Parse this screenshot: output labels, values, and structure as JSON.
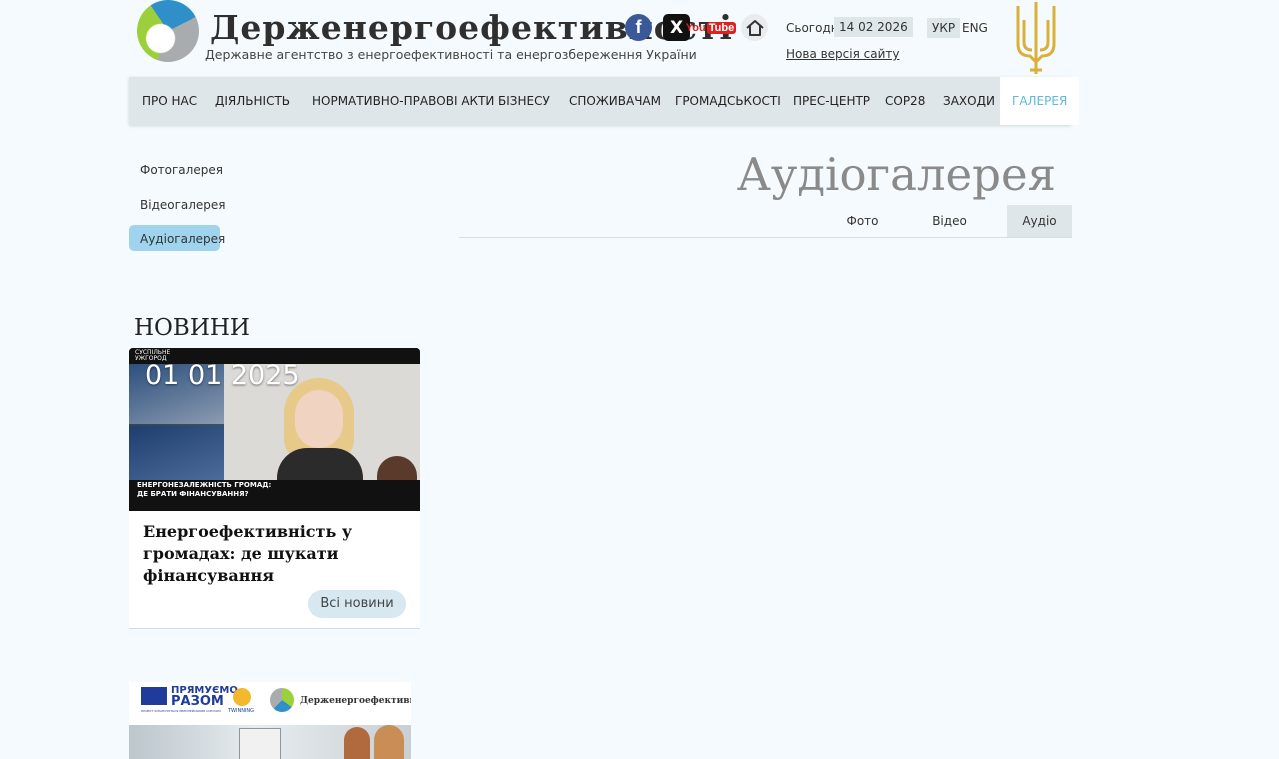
{
  "header": {
    "site_title": "Держенергоефективності",
    "site_subtitle": "Державне агентство з енергоефективності та енергозбереження України",
    "today_label": "Сьогодні",
    "today_date": "14 02 2026",
    "new_version_link": "Нова версія сайту",
    "lang_ukr": "УКР",
    "lang_eng": "ENG",
    "social": {
      "facebook": "f",
      "x": "X",
      "youtube_you": "You",
      "youtube_tube": "Tube"
    }
  },
  "nav": {
    "items": [
      {
        "label": "ПРО НАС"
      },
      {
        "label": "ДІЯЛЬНІСТЬ"
      },
      {
        "label": "НОРМАТИВНО-ПРАВОВІ АКТИ"
      },
      {
        "label": "БІЗНЕСУ"
      },
      {
        "label": "СПОЖИВАЧАМ"
      },
      {
        "label": "ГРОМАДСЬКОСТІ"
      },
      {
        "label": "ПРЕС-ЦЕНТР"
      },
      {
        "label": "COP28"
      },
      {
        "label": "ЗАХОДИ"
      },
      {
        "label": "ГАЛЕРЕЯ"
      }
    ],
    "active": "ГАЛЕРЕЯ"
  },
  "sidebar": {
    "items": [
      {
        "label": "Фотогалерея"
      },
      {
        "label": "Відеогалерея"
      },
      {
        "label": "Аудіогалерея"
      }
    ],
    "active": "Аудіогалерея"
  },
  "main": {
    "title": "Аудіогалерея",
    "tabs": [
      {
        "label": "Фото"
      },
      {
        "label": "Відео"
      },
      {
        "label": "Аудіо"
      }
    ],
    "active_tab": "Аудіо"
  },
  "news": {
    "heading": "НОВИНИ",
    "date": "01 01 2025",
    "title": "Енергоефективність у громадах: де шукати фінансування",
    "image_caption": "ЕНЕРГОНЕЗАЛЕЖНІСТЬ ГРОМАД: ДЕ БРАТИ ФІНАНСУВАННЯ?",
    "image_channel": "СУСПІЛЬНЕ УЖГОРОД",
    "all_news_button": "Всі новини"
  },
  "banner": {
    "eu_text_top": "ПРЯМУЄМО",
    "eu_text_bottom": "РАЗОМ",
    "eu_note": "ПРОЕКТ ФІНАНСУЄТЬСЯ ЄВРОПЕЙСЬКИМ СОЮЗОМ",
    "twinning": "TWINNING",
    "agency": "Держенергоефективності"
  },
  "colors": {
    "background": "#f4fafd",
    "nav_bg": "#dfe6ea",
    "accent": "#5fb8e0",
    "sidebar_active": "#9fd3ee"
  }
}
